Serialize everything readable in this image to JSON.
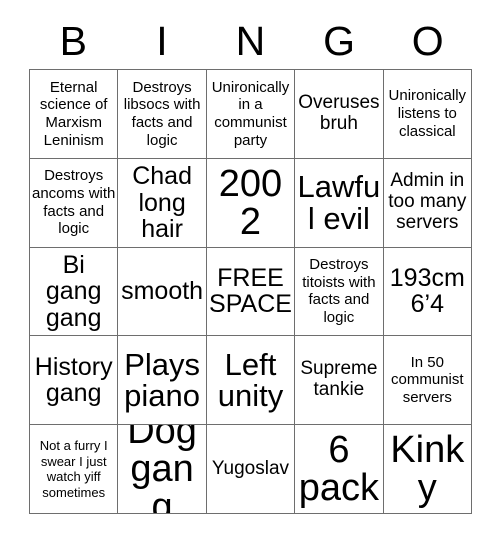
{
  "card": {
    "title": "BINGO",
    "header_letters": [
      "B",
      "I",
      "N",
      "G",
      "O"
    ],
    "grid_size": "5x5",
    "free_space_text": "FREE SPACE",
    "colors": {
      "background": "#ffffff",
      "text": "#000000",
      "grid_line": "#6e6e6e"
    },
    "cells": [
      {
        "row": 1,
        "col": 1,
        "column_letter": "B",
        "text": "Eternal science of Marxism Leninism",
        "size": "fs-xs"
      },
      {
        "row": 1,
        "col": 2,
        "column_letter": "I",
        "text": "Destroys libsocs with facts and logic",
        "size": "fs-xs"
      },
      {
        "row": 1,
        "col": 3,
        "column_letter": "N",
        "text": "Unironically in a communist party",
        "size": "fs-xs"
      },
      {
        "row": 1,
        "col": 4,
        "column_letter": "G",
        "text": "Overuses bruh",
        "size": "fs-sm"
      },
      {
        "row": 1,
        "col": 5,
        "column_letter": "O",
        "text": "Unironically listens to classical",
        "size": "fs-xs"
      },
      {
        "row": 2,
        "col": 1,
        "column_letter": "B",
        "text": "Destroys ancoms with facts and logic",
        "size": "fs-xs"
      },
      {
        "row": 2,
        "col": 2,
        "column_letter": "I",
        "text": "Chad long hair",
        "size": "fs-md"
      },
      {
        "row": 2,
        "col": 3,
        "column_letter": "N",
        "text": "2002",
        "size": "fs-xl"
      },
      {
        "row": 2,
        "col": 4,
        "column_letter": "G",
        "text": "Lawful evil",
        "size": "fs-lg"
      },
      {
        "row": 2,
        "col": 5,
        "column_letter": "O",
        "text": "Admin in too many servers",
        "size": "fs-sm"
      },
      {
        "row": 3,
        "col": 1,
        "column_letter": "B",
        "text": "Bi gang gang",
        "size": "fs-md"
      },
      {
        "row": 3,
        "col": 2,
        "column_letter": "I",
        "text": "smooth",
        "size": "fs-md"
      },
      {
        "row": 3,
        "col": 3,
        "column_letter": "N",
        "text": "FREE SPACE",
        "size": "fs-md"
      },
      {
        "row": 3,
        "col": 4,
        "column_letter": "G",
        "text": "Destroys titoists with facts and logic",
        "size": "fs-xs"
      },
      {
        "row": 3,
        "col": 5,
        "column_letter": "O",
        "text": "193cm 6’4",
        "size": "fs-md"
      },
      {
        "row": 4,
        "col": 1,
        "column_letter": "B",
        "text": "History gang",
        "size": "fs-md"
      },
      {
        "row": 4,
        "col": 2,
        "column_letter": "I",
        "text": "Plays piano",
        "size": "fs-lg"
      },
      {
        "row": 4,
        "col": 3,
        "column_letter": "N",
        "text": "Left unity",
        "size": "fs-lg"
      },
      {
        "row": 4,
        "col": 4,
        "column_letter": "G",
        "text": "Supreme tankie",
        "size": "fs-sm"
      },
      {
        "row": 4,
        "col": 5,
        "column_letter": "O",
        "text": "In 50 communist servers",
        "size": "fs-xs"
      },
      {
        "row": 5,
        "col": 1,
        "column_letter": "B",
        "text": "Not a furry I swear I just watch yiff sometimes",
        "size": "fs-xxs"
      },
      {
        "row": 5,
        "col": 2,
        "column_letter": "I",
        "text": "Dog gang",
        "size": "fs-xl"
      },
      {
        "row": 5,
        "col": 3,
        "column_letter": "N",
        "text": "Yugoslav",
        "size": "fs-sm"
      },
      {
        "row": 5,
        "col": 4,
        "column_letter": "G",
        "text": "6 pack",
        "size": "fs-xl"
      },
      {
        "row": 5,
        "col": 5,
        "column_letter": "O",
        "text": "Kinky",
        "size": "fs-xl"
      }
    ]
  }
}
